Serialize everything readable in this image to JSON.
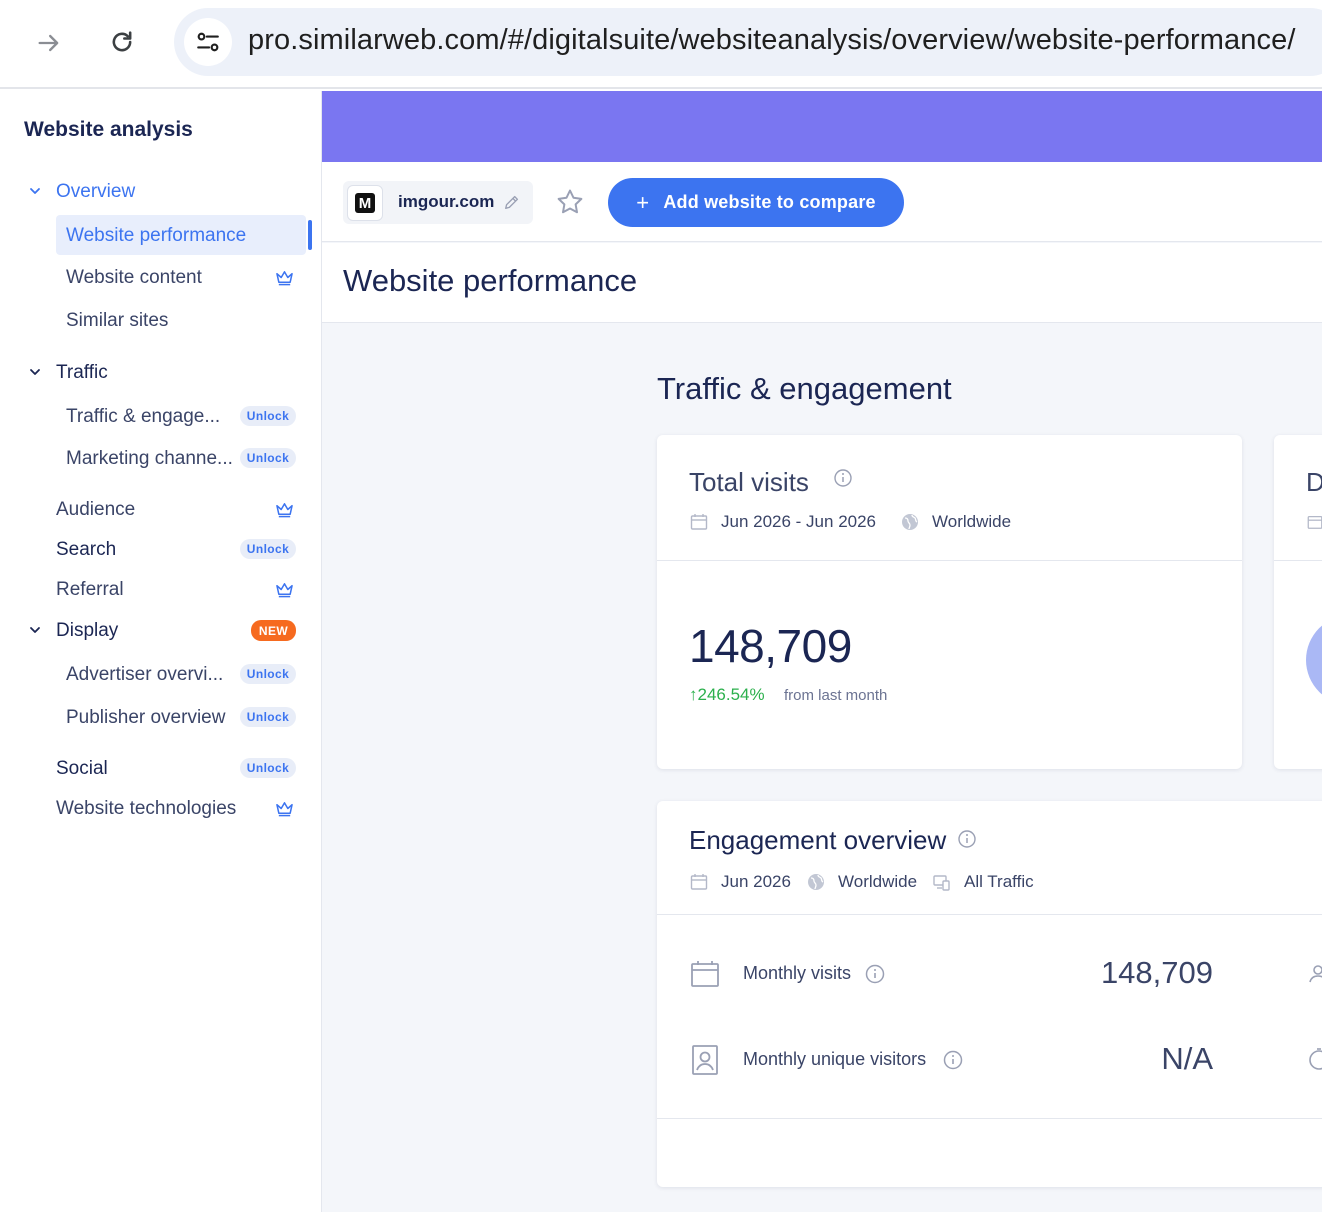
{
  "browser": {
    "url": "pro.similarweb.com/#/digitalsuite/websiteanalysis/overview/website-performance/"
  },
  "sidebar": {
    "title": "Website analysis",
    "overview": {
      "label": "Overview",
      "items": [
        {
          "label": "Website performance"
        },
        {
          "label": "Website content"
        },
        {
          "label": "Similar sites"
        }
      ]
    },
    "traffic": {
      "label": "Traffic",
      "items": [
        {
          "label": "Traffic & engage...",
          "badge": "Unlock"
        },
        {
          "label": "Marketing channe...",
          "badge": "Unlock"
        }
      ]
    },
    "audience": {
      "label": "Audience"
    },
    "search": {
      "label": "Search",
      "badge": "Unlock"
    },
    "referral": {
      "label": "Referral"
    },
    "display": {
      "label": "Display",
      "badge": "NEW",
      "items": [
        {
          "label": "Advertiser overvi...",
          "badge": "Unlock"
        },
        {
          "label": "Publisher overview",
          "badge": "Unlock"
        }
      ]
    },
    "social": {
      "label": "Social",
      "badge": "Unlock"
    },
    "technologies": {
      "label": "Website technologies"
    }
  },
  "toolbar": {
    "favicon_letter": "M",
    "site": "imgour.com",
    "add_button": "Add website to compare",
    "add_icon": "+"
  },
  "page": {
    "title": "Website performance",
    "section_title": "Traffic & engagement"
  },
  "total_visits": {
    "title": "Total visits",
    "date_range": "Jun 2026 - Jun 2026",
    "region": "Worldwide",
    "value": "148,709",
    "change": "246.54%",
    "change_arrow": "↑",
    "change_note": "from last month"
  },
  "second_card": {
    "title_partial": "D"
  },
  "engagement": {
    "title": "Engagement overview",
    "date": "Jun 2026",
    "region": "Worldwide",
    "traffic": "All Traffic",
    "rows": [
      {
        "label": "Monthly visits",
        "value": "148,709"
      },
      {
        "label": "Monthly unique visitors",
        "value": "N/A"
      }
    ]
  },
  "colors": {
    "accent": "#3c74f0",
    "banner": "#7a76f1",
    "positive": "#2bb04c",
    "new_badge": "#f66a1f"
  }
}
